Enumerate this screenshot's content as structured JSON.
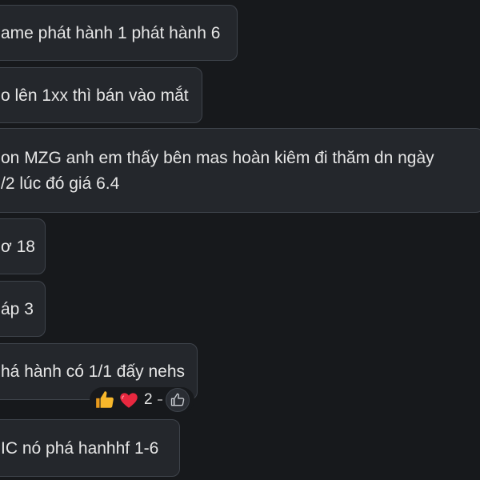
{
  "messages": [
    {
      "text": "ame phát hành 1 phát hành 6"
    },
    {
      "text": "o lên 1xx thì bán vào mắt"
    },
    {
      "lines": [
        "on MZG anh em thấy bên mas hoàn kiêm đi thăm dn ngày",
        "/2  lúc đó giá 6.4"
      ]
    },
    {
      "text": "ơ 18"
    },
    {
      "text": "áp 3"
    },
    {
      "text": "há hành có 1/1 đấy nehs"
    },
    {
      "text": "IC nó phá hanhhf 1-6"
    }
  ],
  "reactions": {
    "emojis": [
      "thumbs-up-icon",
      "heart-icon"
    ],
    "count": "2",
    "add_icon": "thumbs-up-outline-icon"
  },
  "colors": {
    "background": "#17191c",
    "bubble": "#24272c",
    "bubble_border": "#3e434b",
    "text": "#e6e6e6",
    "heart": "#e8283f",
    "thumb": "#f7b72b"
  }
}
